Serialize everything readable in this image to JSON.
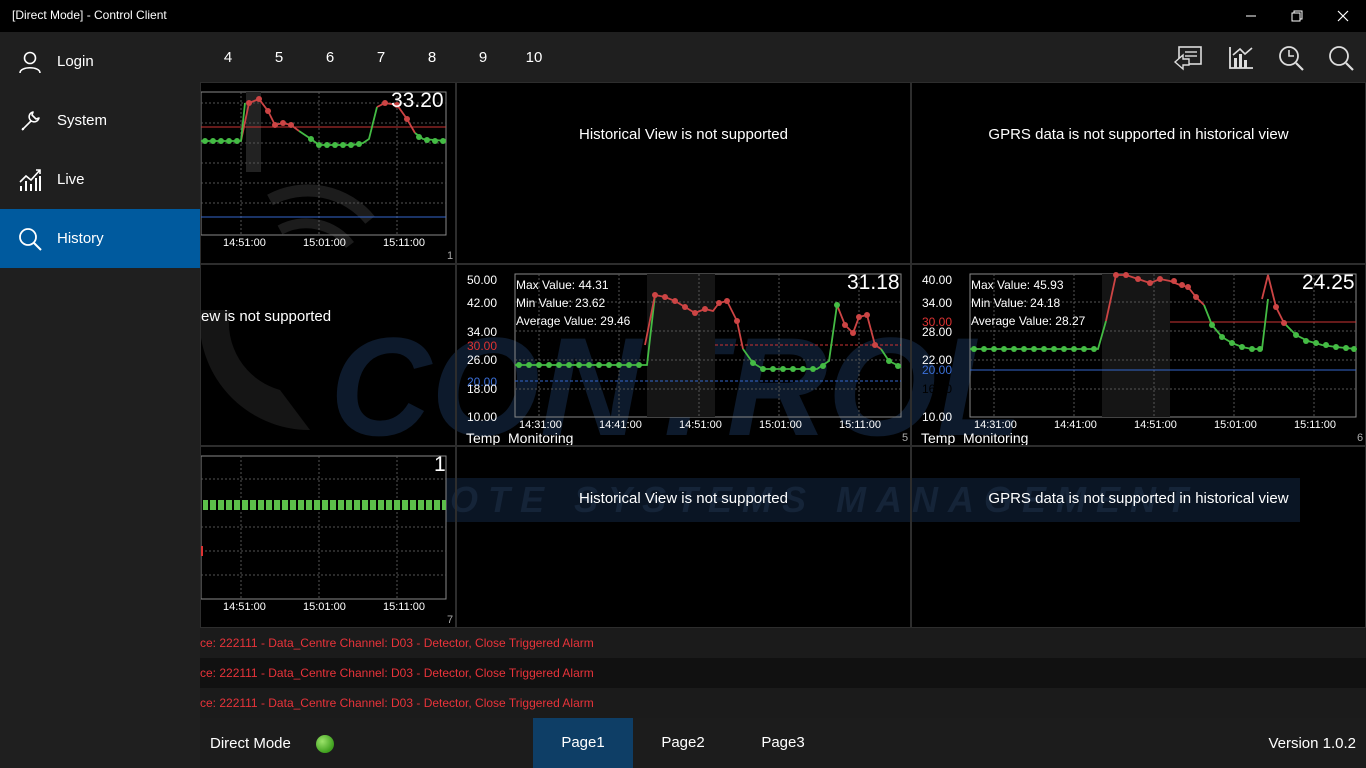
{
  "window": {
    "title": "[Direct Mode] - Control Client"
  },
  "sidebar": {
    "items": [
      {
        "label": "Login",
        "icon": "user-icon"
      },
      {
        "label": "System",
        "icon": "wrench-icon"
      },
      {
        "label": "Live",
        "icon": "line-chart-icon"
      },
      {
        "label": "History",
        "icon": "search-icon",
        "active": true
      }
    ],
    "active_color": "#005a9e"
  },
  "toolbar": {
    "page_numbers": [
      "4",
      "5",
      "6",
      "7",
      "8",
      "9",
      "10"
    ],
    "icons": [
      "report-icon",
      "chart-icon",
      "clock-search-icon",
      "search-icon"
    ]
  },
  "cells": {
    "c1": {
      "value": "33.20",
      "num": "1",
      "times": [
        "14:51:00",
        "15:01:00",
        "15:11:00"
      ]
    },
    "c2": {
      "message": "Historical View is not supported"
    },
    "c3": {
      "message": "GPRS data is not supported in historical view"
    },
    "c4": {
      "message": "ew is not supported"
    },
    "c5": {
      "value": "31.18",
      "num": "5",
      "max": "Max Value: 44.31",
      "min": "Min Value: 23.62",
      "avg": "Average Value: 29.46",
      "yticks": [
        "50.00",
        "42.00",
        "34.00",
        "30.00",
        "26.00",
        "20.00",
        "18.00",
        "10.00"
      ],
      "times": [
        "14:31:00",
        "14:41:00",
        "14:51:00",
        "15:01:00",
        "15:11:00"
      ],
      "channel": "Temp_Monitoring"
    },
    "c6": {
      "value": "24.25",
      "num": "6",
      "max": "Max Value: 45.93",
      "min": "Min Value: 24.18",
      "avg": "Average Value: 28.27",
      "yticks": [
        "40.00",
        "34.00",
        "30.00",
        "28.00",
        "22.00",
        "20.00",
        "16.00",
        "10.00"
      ],
      "times": [
        "14:31:00",
        "14:41:00",
        "14:51:00",
        "15:01:00",
        "15:11:00"
      ],
      "channel": "Temp_Monitoring"
    },
    "c7": {
      "value": "1",
      "num": "7",
      "times": [
        "14:51:00",
        "15:01:00",
        "15:11:00"
      ]
    },
    "c8": {
      "message": "Historical View is not supported"
    },
    "c9": {
      "message": "GPRS data is not supported in historical view"
    }
  },
  "alarms": [
    "ce: 222111 - Data_Centre Channel: D03 - Detector, Close Triggered Alarm",
    "ce: 222111 - Data_Centre Channel: D03 - Detector, Close Triggered Alarm",
    "ce: 222111 - Data_Centre Channel: D03 - Detector, Close Triggered Alarm"
  ],
  "status": {
    "mode": "Direct Mode",
    "pages": [
      "Page1",
      "Page2",
      "Page3"
    ],
    "active_page": "Page1",
    "version": "Version 1.0.2"
  },
  "watermark": {
    "line1": "CONTROL",
    "line2": "REMOTE SYSTEMS MANAGEMENT"
  }
}
